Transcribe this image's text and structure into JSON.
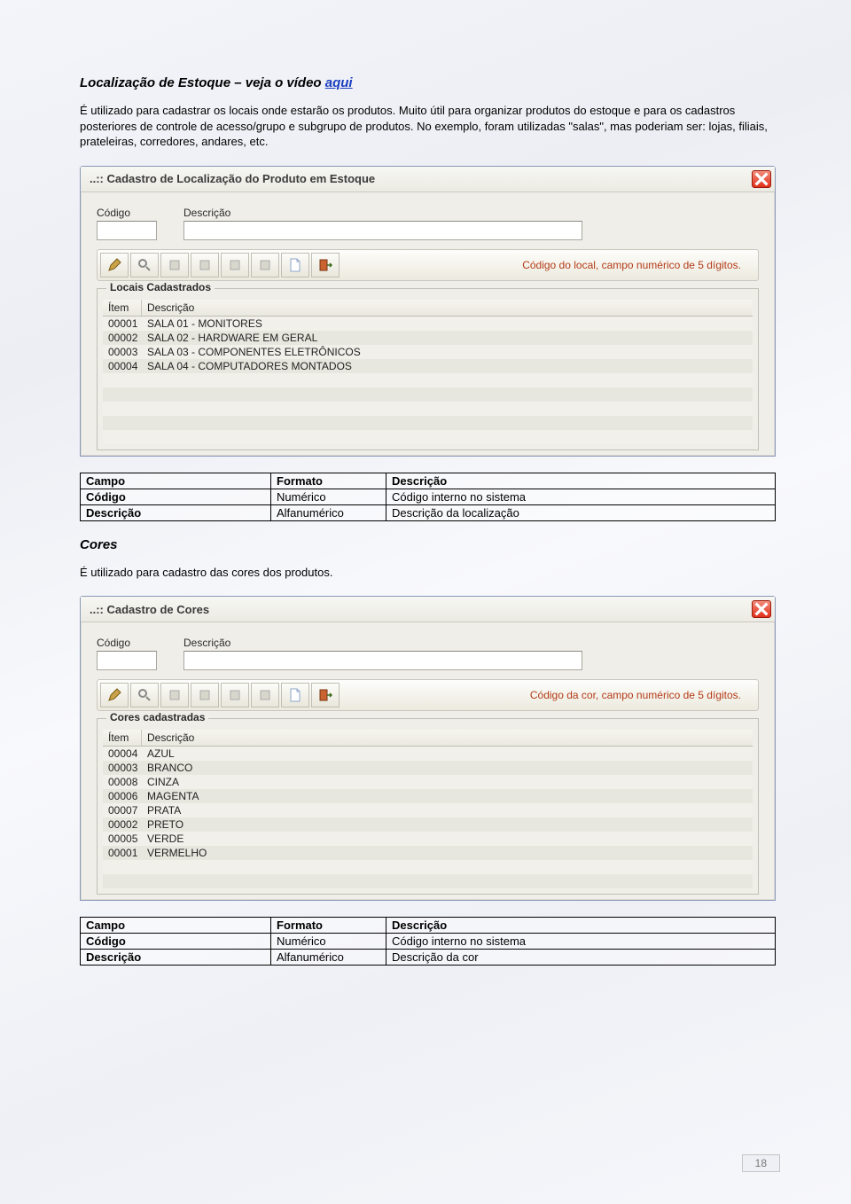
{
  "section1": {
    "heading_prefix": "Localização de Estoque – veja o vídeo ",
    "heading_link": "aqui",
    "paragraph": "É utilizado para cadastrar os locais onde estarão os produtos. Muito útil para organizar produtos do estoque e para os cadastros posteriores de controle de acesso/grupo e subgrupo de produtos. No exemplo, foram utilizadas \"salas\", mas poderiam ser: lojas, filiais, prateleiras, corredores, andares, etc."
  },
  "win1": {
    "title": "..:: Cadastro de Localização do Produto em Estoque",
    "f_codigo": "Código",
    "f_desc": "Descrição",
    "status": "Código do local, campo numérico de 5 dígitos.",
    "group": "Locais Cadastrados",
    "hdr_item": "Ítem",
    "hdr_desc": "Descrição",
    "rows": [
      {
        "item": "00001",
        "desc": "SALA 01 - MONITORES"
      },
      {
        "item": "00002",
        "desc": "SALA 02 - HARDWARE EM GERAL"
      },
      {
        "item": "00003",
        "desc": "SALA 03 - COMPONENTES ELETRÔNICOS"
      },
      {
        "item": "00004",
        "desc": "SALA 04 - COMPUTADORES MONTADOS"
      }
    ]
  },
  "table1": {
    "h1": "Campo",
    "h2": "Formato",
    "h3": "Descrição",
    "r1c1": "Código",
    "r1c2": "Numérico",
    "r1c3": "Código interno no sistema",
    "r2c1": "Descrição",
    "r2c2": "Alfanumérico",
    "r2c3": "Descrição da localização"
  },
  "section2": {
    "heading": "Cores",
    "paragraph": "É utilizado para cadastro das cores dos produtos."
  },
  "win2": {
    "title": "..:: Cadastro de Cores",
    "f_codigo": "Código",
    "f_desc": "Descrição",
    "status": "Código da cor, campo numérico de 5 dígitos.",
    "group": "Cores cadastradas",
    "hdr_item": "Ítem",
    "hdr_desc": "Descrição",
    "rows": [
      {
        "item": "00004",
        "desc": "AZUL"
      },
      {
        "item": "00003",
        "desc": "BRANCO"
      },
      {
        "item": "00008",
        "desc": "CINZA"
      },
      {
        "item": "00006",
        "desc": "MAGENTA"
      },
      {
        "item": "00007",
        "desc": "PRATA"
      },
      {
        "item": "00002",
        "desc": "PRETO"
      },
      {
        "item": "00005",
        "desc": "VERDE"
      },
      {
        "item": "00001",
        "desc": "VERMELHO"
      }
    ]
  },
  "table2": {
    "h1": "Campo",
    "h2": "Formato",
    "h3": "Descrição",
    "r1c1": "Código",
    "r1c2": "Numérico",
    "r1c3": "Código interno no sistema",
    "r2c1": "Descrição",
    "r2c2": "Alfanumérico",
    "r2c3": "Descrição da cor"
  },
  "page_number": "18"
}
